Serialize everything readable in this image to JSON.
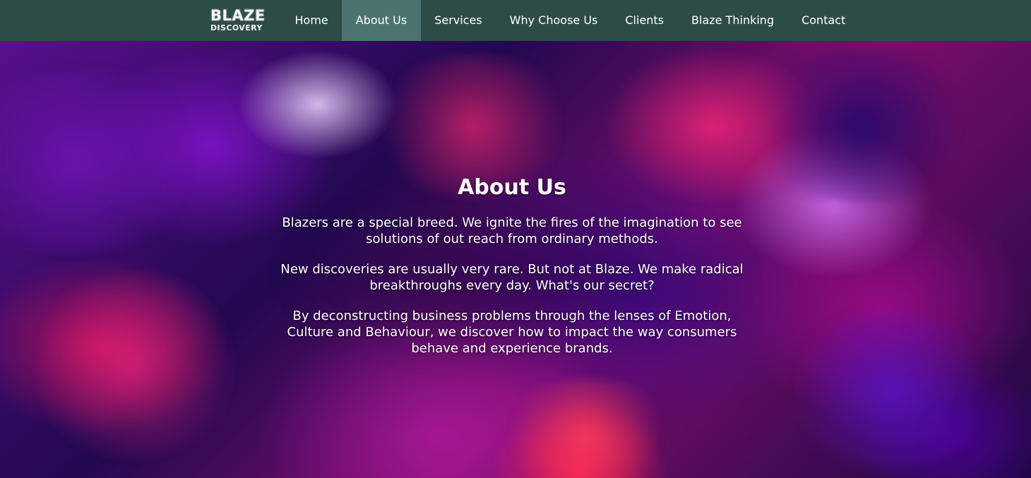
{
  "brand": {
    "logo_top": "BLAZE",
    "logo_bottom": "DISCOVERY"
  },
  "nav": {
    "items": [
      {
        "label": "Home"
      },
      {
        "label": "About Us"
      },
      {
        "label": "Services"
      },
      {
        "label": "Why Choose Us"
      },
      {
        "label": "Clients"
      },
      {
        "label": "Blaze Thinking"
      },
      {
        "label": "Contact"
      }
    ],
    "active": "About Us"
  },
  "hero": {
    "title": "About Us",
    "paragraphs": [
      "Blazers are a special breed. We ignite the fires of the imagination to see solutions of out reach from ordinary methods.",
      "New discoveries are usually very rare. But not at Blaze. We make radical breakthroughs every day. What's our secret?",
      "By deconstructing business problems through the lenses of Emotion, Culture and Behaviour, we discover how to impact the way consumers behave and experience brands."
    ]
  },
  "colors": {
    "navbar": "#2e4c47",
    "active_nav": "#4b7470",
    "text": "#ffffff"
  }
}
